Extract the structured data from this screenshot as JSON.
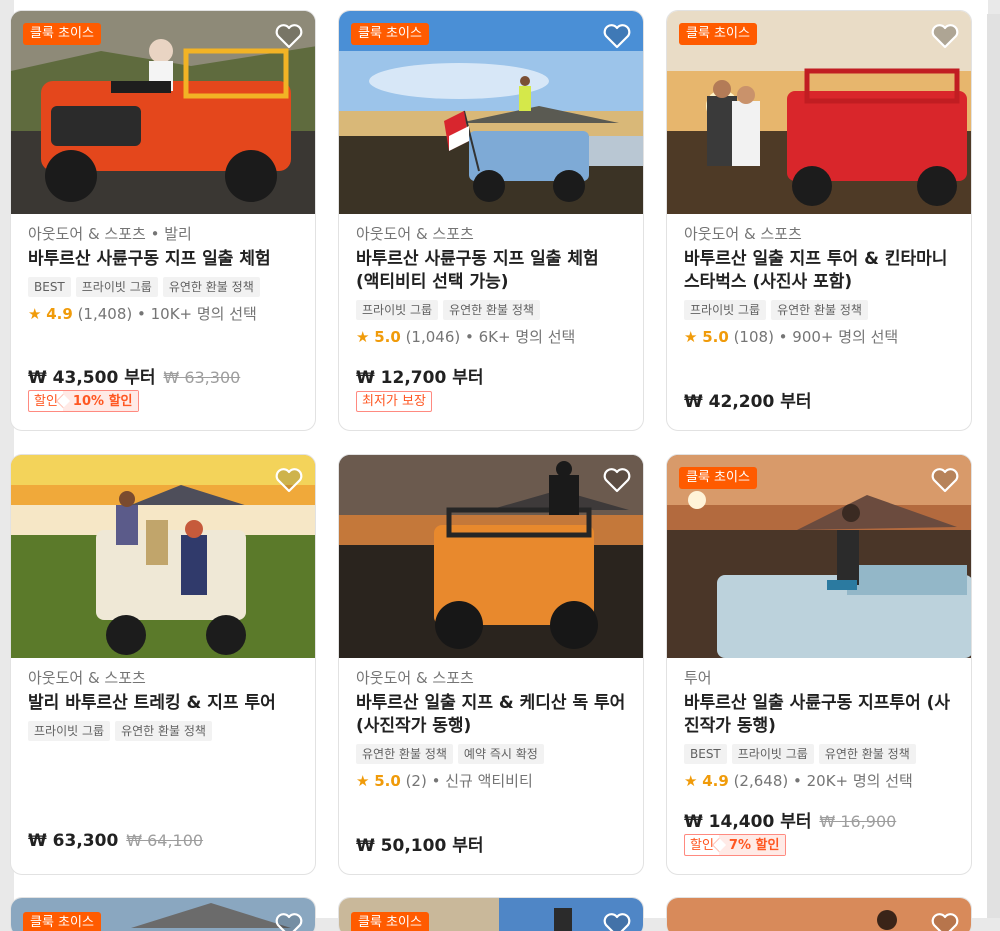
{
  "cards": [
    {
      "badge": "클룩 초이스",
      "category": "아웃도어 & 스포츠 • 발리",
      "title": "바투르산 사륜구동 지프 일출 체험",
      "tags": [
        "BEST",
        "프라이빗 그룹",
        "유연한 환불 정책"
      ],
      "rating": {
        "star": "★",
        "score": "4.9",
        "rest": " (1,408) • 10K+ 명의 선택"
      },
      "price": "₩ 43,500 부터",
      "old_price": "₩ 63,300",
      "promo": {
        "label": "할인",
        "value": "10% 할인"
      }
    },
    {
      "badge": "클룩 초이스",
      "category": "아웃도어 & 스포츠",
      "title": "바투르산 사륜구동 지프 일출 체험 (액티비티 선택 가능)",
      "tags": [
        "프라이빗 그룹",
        "유연한 환불 정책"
      ],
      "rating": {
        "star": "★",
        "score": "5.0",
        "rest": " (1,046) • 6K+ 명의 선택"
      },
      "price": "₩ 12,700 부터",
      "guarantee": "최저가 보장"
    },
    {
      "badge": "클룩 초이스",
      "category": "아웃도어 & 스포츠",
      "title": "바투르산 일출 지프 투어 & 킨타마니 스타벅스 (사진사 포함)",
      "tags": [
        "프라이빗 그룹",
        "유연한 환불 정책"
      ],
      "rating": {
        "star": "★",
        "score": "5.0",
        "rest": " (108) • 900+ 명의 선택"
      },
      "price": "₩ 42,200 부터"
    },
    {
      "category": "아웃도어 & 스포츠",
      "title": "발리 바투르산 트레킹 & 지프 투어",
      "tags": [
        "프라이빗 그룹",
        "유연한 환불 정책"
      ],
      "price": "₩ 63,300",
      "old_price": "₩ 64,100"
    },
    {
      "category": "아웃도어 & 스포츠",
      "title": "바투르산 일출 지프 & 케디산 독 투어 (사진작가 동행)",
      "tags": [
        "유연한 환불 정책",
        "예약 즉시 확정"
      ],
      "rating": {
        "star": "★",
        "score": "5.0",
        "rest": " (2) • 신규 액티비티"
      },
      "price": "₩ 50,100 부터"
    },
    {
      "badge": "클룩 초이스",
      "category": "투어",
      "title": "바투르산 일출 사륜구동 지프투어 (사진작가 동행)",
      "tags": [
        "BEST",
        "프라이빗 그룹",
        "유연한 환불 정책"
      ],
      "rating": {
        "star": "★",
        "score": "4.9",
        "rest": " (2,648) • 20K+ 명의 선택"
      },
      "price": "₩ 14,400 부터",
      "old_price": "₩ 16,900",
      "promo": {
        "label": "할인",
        "value": "7% 할인"
      }
    },
    {
      "badge": "클룩 초이스"
    },
    {
      "badge": "클룩 초이스"
    },
    {}
  ],
  "colors": {
    "accent": "#ff5b00",
    "star": "#f09b0a",
    "discount": "#ff5722"
  }
}
